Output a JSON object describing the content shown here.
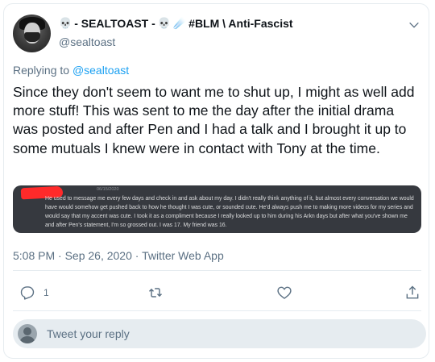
{
  "author": {
    "display_name_prefix_emoji": "💀",
    "display_name_part1": "- SEALTOAST -",
    "display_name_emoji2": "💀",
    "display_name_emoji3": "☄️",
    "display_name_part2": "#BLM \\ Anti-Fascist",
    "handle": "@sealtoast"
  },
  "replying": {
    "prefix": "Replying to",
    "mention": "@sealtoast"
  },
  "tweet": {
    "text": "Since they don't seem to want me to shut up, I might as well add more stuff! This was sent to me the day after the initial drama was posted and after Pen and I had a talk and I brought it up to some mutuals I knew were in contact with Tony at the time.",
    "timestamp": "5:08 PM · Sep 26, 2020 · Twitter Web App"
  },
  "media": {
    "message_timestamp": "06/15/2020",
    "message_text": "He used to message me every few days and check in and ask about my day. I didn't really think anything of it, but almost every conversation we would have would somehow get pushed back to how he thought I was cute, or sounded cute. He'd always push me to making more videos for my series and would say that my accent was cute. I took it as a compliment because I really looked up to him during his Arkn days but after what you've shown me and after Pen's statement, I'm so grossed out. I was 17. My friend was 16."
  },
  "actions": {
    "reply_count": "1"
  },
  "reply_box": {
    "placeholder": "Tweet your reply"
  },
  "colors": {
    "accent": "#1da1f2",
    "secondary_text": "#5b7083",
    "redaction": "#ff2a2a",
    "media_bg": "#36393f"
  },
  "icons": [
    "skull-icon",
    "comet-icon",
    "chevron-down-icon",
    "reply-icon",
    "retweet-icon",
    "like-icon",
    "share-icon",
    "user-avatar-icon"
  ]
}
